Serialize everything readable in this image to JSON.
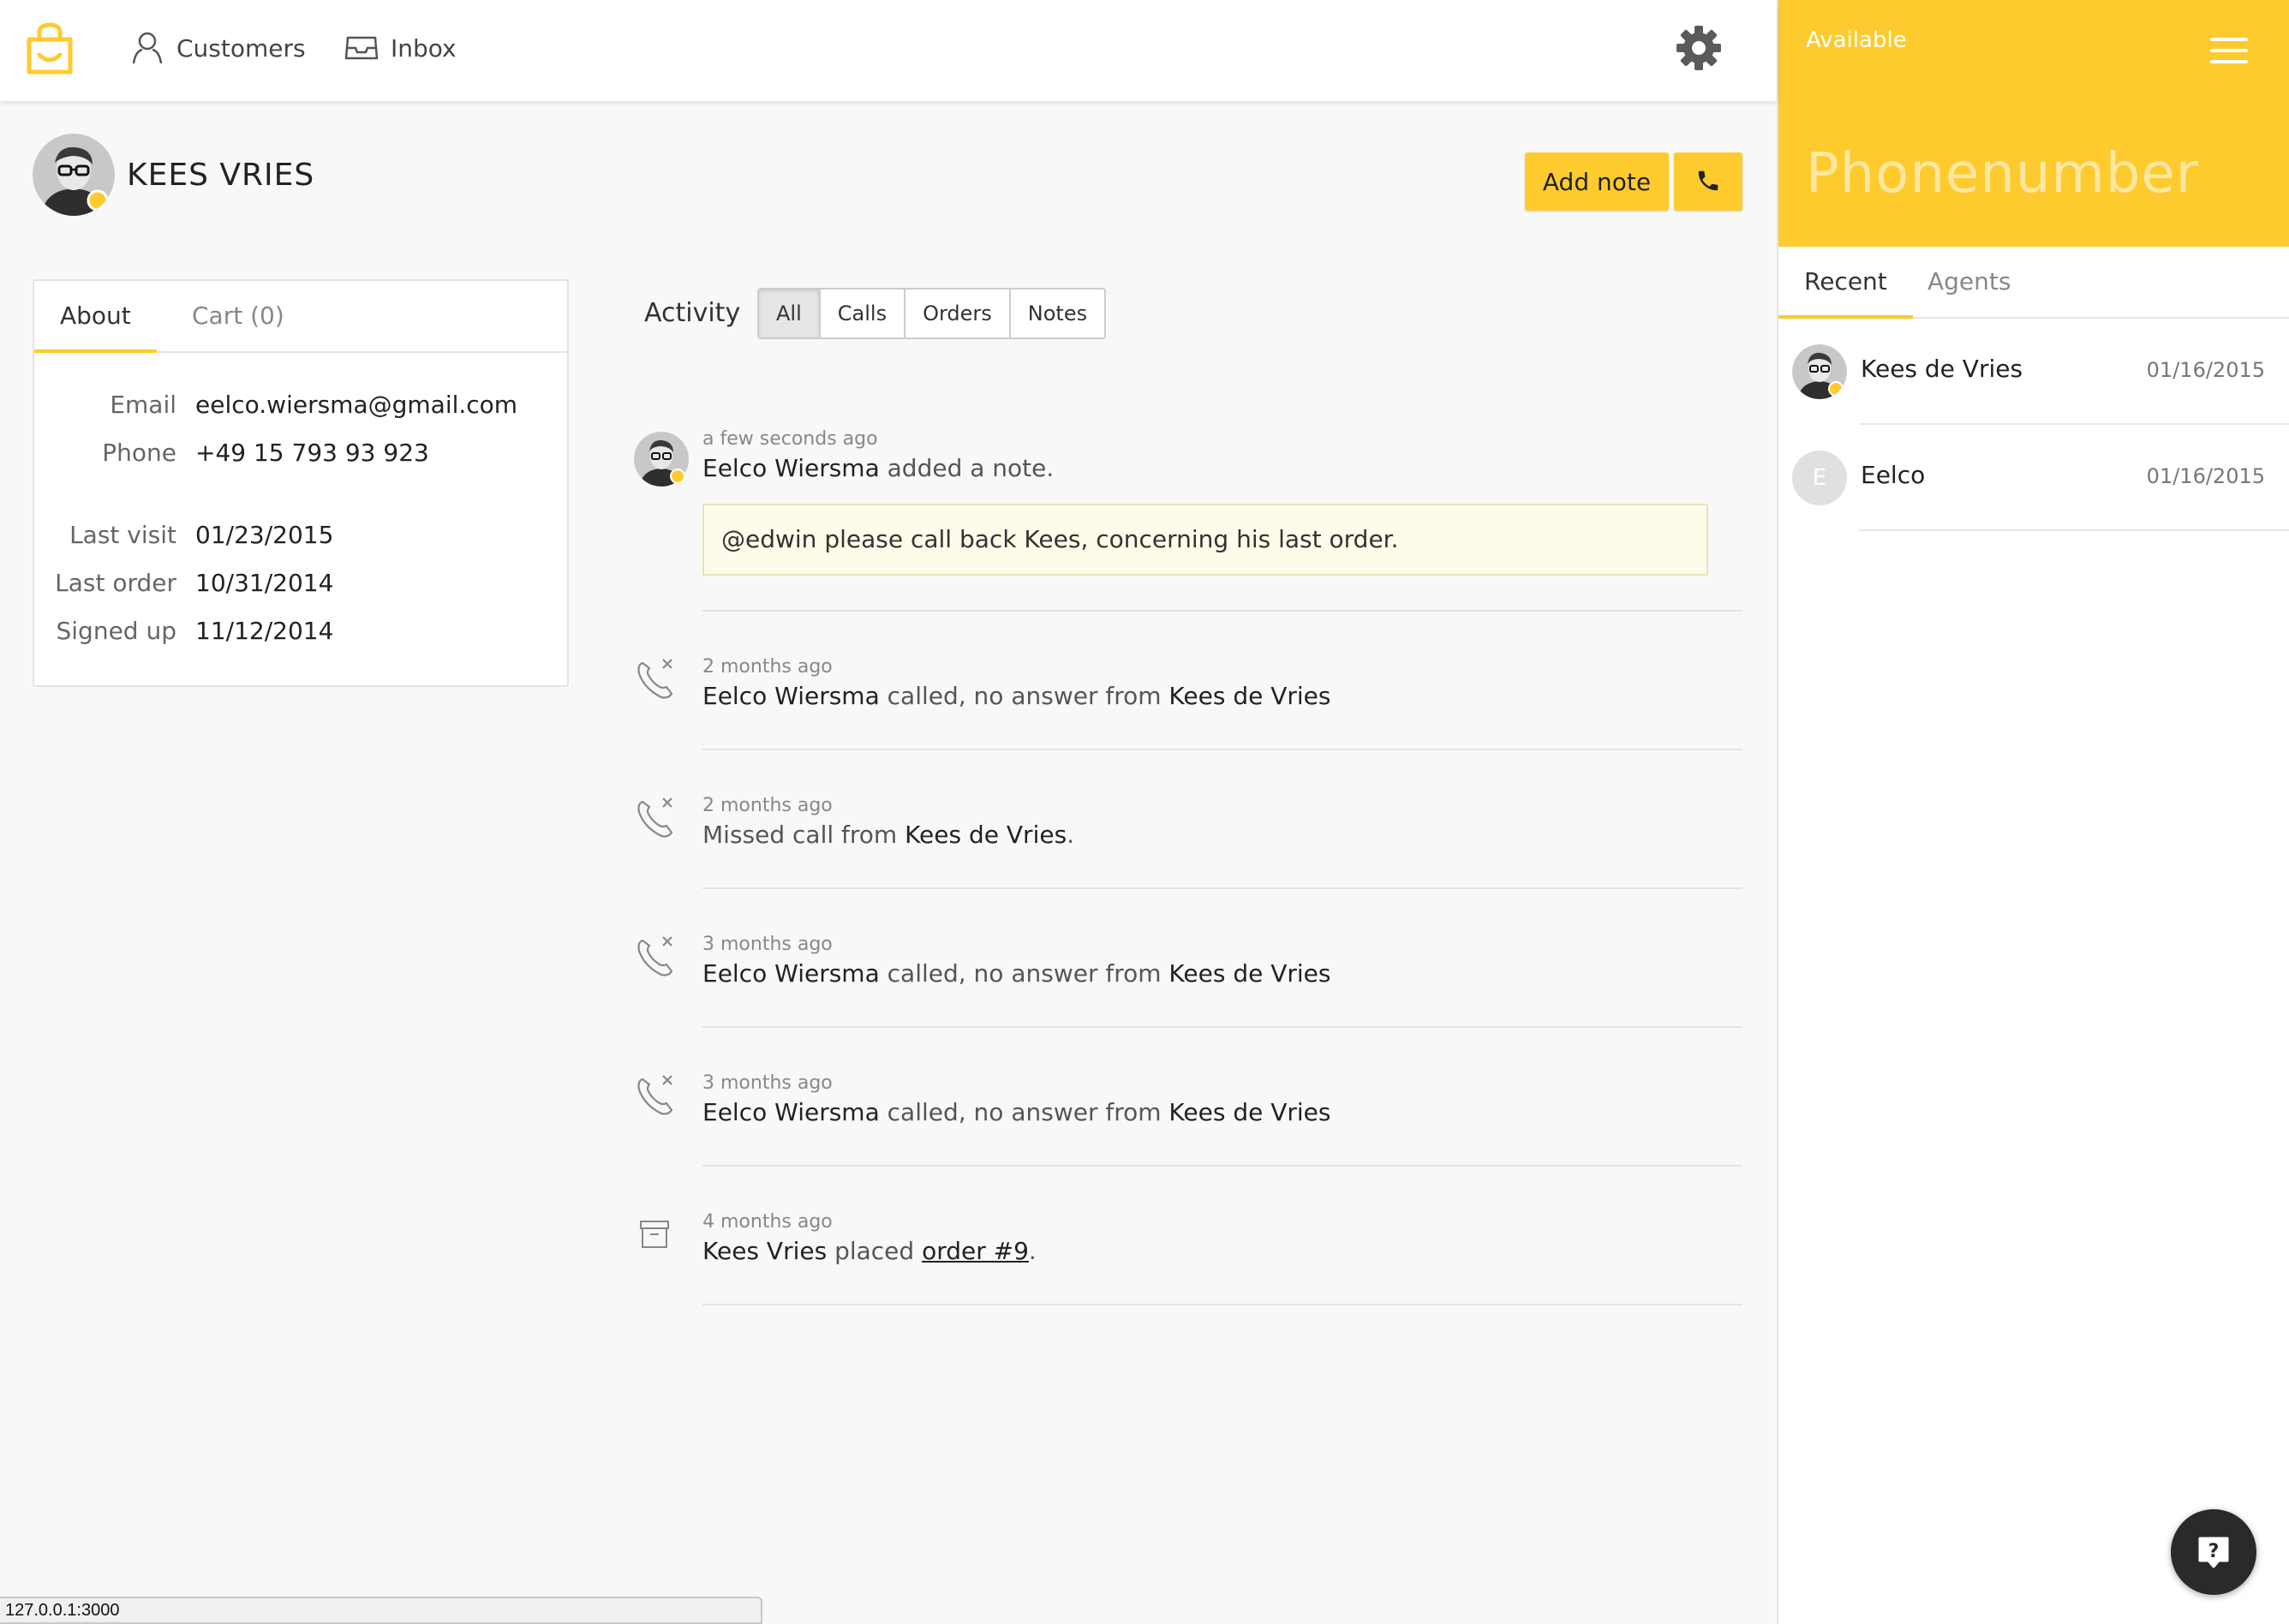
{
  "nav": {
    "logo_icon": "shopping-bag-smile-icon",
    "customers_label": "Customers",
    "inbox_label": "Inbox",
    "settings_icon": "gear-icon"
  },
  "customer": {
    "name": "KEES VRIES",
    "add_note_label": "Add note",
    "call_icon": "phone-icon"
  },
  "about": {
    "tabs": [
      "About",
      "Cart (0)"
    ],
    "rows": [
      {
        "label": "Email",
        "value": "eelco.wiersma@gmail.com"
      },
      {
        "label": "Phone",
        "value": "+49 15 793 93 923"
      },
      {
        "label": "Last visit",
        "value": "01/23/2015"
      },
      {
        "label": "Last order",
        "value": "10/31/2014"
      },
      {
        "label": "Signed up",
        "value": "11/12/2014"
      }
    ]
  },
  "activity": {
    "label": "Activity",
    "filters": [
      "All",
      "Calls",
      "Orders",
      "Notes"
    ],
    "active_filter": "All",
    "items": [
      {
        "type": "note",
        "time": "a few seconds ago",
        "actor": "Eelco Wiersma",
        "text": " added a note.",
        "note": "@edwin please call back Kees, concerning his last order."
      },
      {
        "type": "call",
        "time": "2 months ago",
        "actor": "Eelco Wiersma",
        "text": " called, no answer from ",
        "target": "Kees de Vries"
      },
      {
        "type": "missed",
        "time": "2 months ago",
        "prefix": "Missed call from ",
        "target": "Kees de Vries",
        "suffix": "."
      },
      {
        "type": "call",
        "time": "3 months ago",
        "actor": "Eelco Wiersma",
        "text": " called, no answer from ",
        "target": "Kees de Vries"
      },
      {
        "type": "call",
        "time": "3 months ago",
        "actor": "Eelco Wiersma",
        "text": " called, no answer from ",
        "target": "Kees de Vries"
      },
      {
        "type": "order",
        "time": "4 months ago",
        "actor": "Kees Vries",
        "text": " placed ",
        "link": "order #9",
        "suffix": "."
      }
    ]
  },
  "panel": {
    "status": "Available",
    "phone_placeholder": "Phonenumber",
    "tabs": [
      "Recent",
      "Agents"
    ],
    "recent": [
      {
        "name": "Kees de Vries",
        "date": "01/16/2015",
        "avatar": "photo"
      },
      {
        "name": "Eelco",
        "date": "01/16/2015",
        "initial": "E"
      }
    ]
  },
  "statusbar": {
    "url": "127.0.0.1:3000"
  },
  "colors": {
    "accent": "#fecb2e",
    "note_bg": "#fdfbe9"
  }
}
